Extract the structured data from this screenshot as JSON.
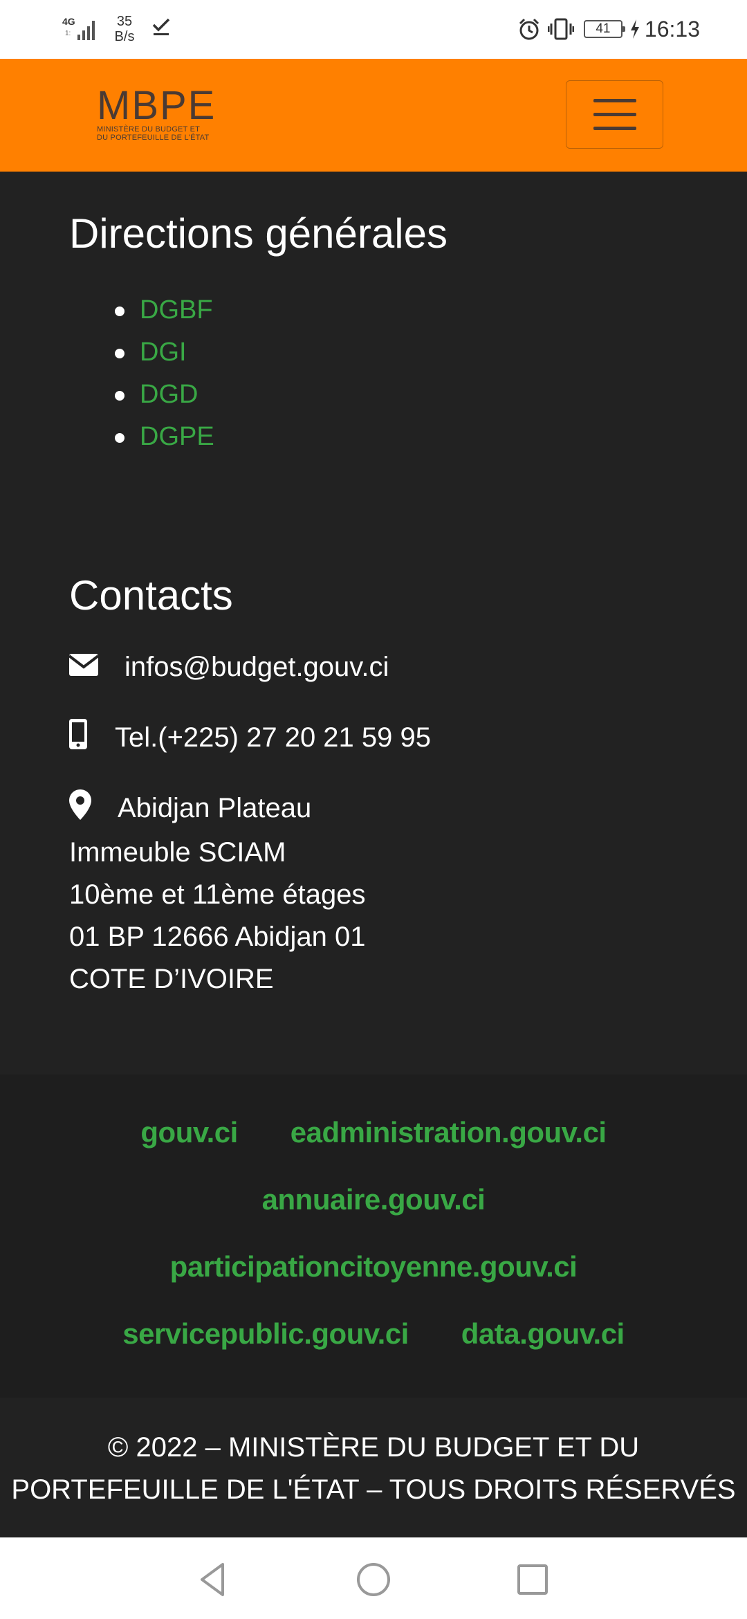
{
  "status_bar": {
    "network_type": "4G",
    "network_sub": "1:",
    "speed_value": "35",
    "speed_unit": "B/s",
    "battery_level": "41",
    "time": "16:13",
    "icons": [
      "signal-icon",
      "download-done-icon",
      "alarm-icon",
      "vibrate-icon",
      "battery-icon",
      "charging-icon"
    ]
  },
  "header": {
    "logo_mark": "MBPE",
    "logo_sub_line1": "MINISTÈRE DU BUDGET ET",
    "logo_sub_line2": "DU PORTEFEUILLE DE L'ÉTAT",
    "menu_icon": "hamburger-icon",
    "accent_color": "#ff8000"
  },
  "directions": {
    "title": "Directions générales",
    "items": [
      "DGBF",
      "DGI",
      "DGD",
      "DGPE"
    ],
    "link_color": "#39a845"
  },
  "contacts": {
    "title": "Contacts",
    "email": "infos@budget.gouv.ci",
    "phone": "Tel.(+225) 27 20 21 59 95",
    "address_first_line": "Abidjan Plateau",
    "address_lines": [
      "Immeuble SCIAM",
      "10ème et 11ème étages",
      "01 BP 12666 Abidjan 01",
      "COTE D’IVOIRE"
    ],
    "icons": [
      "envelope-icon",
      "mobile-phone-icon",
      "map-marker-icon"
    ]
  },
  "links": {
    "row1": [
      "gouv.ci",
      "eadministration.gouv.ci"
    ],
    "row2": [
      "annuaire.gouv.ci"
    ],
    "row3": [
      "participationcitoyenne.gouv.ci"
    ],
    "row4": [
      "servicepublic.gouv.ci",
      "data.gouv.ci"
    ]
  },
  "footer": {
    "copyright_line1": "© 2022 – MINISTÈRE DU BUDGET ET DU",
    "copyright_line2": "PORTEFEUILLE DE L'ÉTAT – TOUS DROITS RÉSERVÉS"
  },
  "nav_bar": {
    "icons": [
      "back-triangle-icon",
      "home-circle-icon",
      "recent-square-icon"
    ]
  }
}
